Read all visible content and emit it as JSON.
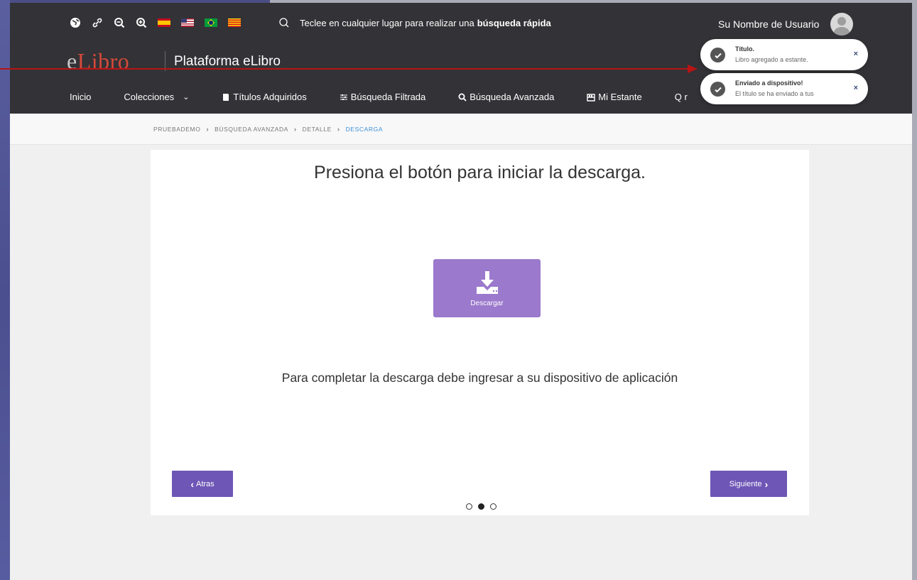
{
  "header": {
    "icons": [
      "globe-icon",
      "link-icon",
      "zoom-out-icon",
      "zoom-in-icon"
    ],
    "flags": [
      "flag-spain",
      "flag-usa",
      "flag-brazil",
      "flag-catalonia"
    ],
    "quick_search_text": "Teclee en cualquier lugar para realizar una",
    "quick_search_bold": "búsqueda rápida",
    "username": "Su Nombre de Usuario",
    "logo_e": "e",
    "logo_libro": "Libro",
    "platform_name": "Plataforma eLibro"
  },
  "nav": {
    "items": [
      {
        "label": "Inicio"
      },
      {
        "label": "Colecciones",
        "chevron": "⌄"
      },
      {
        "label": "Títulos Adquiridos"
      },
      {
        "label": "Búsqueda Filtrada"
      },
      {
        "label": "Búsqueda Avanzada"
      },
      {
        "label": "Mi Estante"
      },
      {
        "label": "Q r"
      }
    ]
  },
  "breadcrumb": {
    "items": [
      "PRUEBADEMO",
      "BÚSQUEDA AVANZADA",
      "DETALLE",
      "DESCARGA"
    ],
    "separator": "›"
  },
  "main": {
    "title": "Presiona el botón para iniciar la descarga.",
    "download_label": "Descargar",
    "message": "Para completar la descarga debe ingresar a su dispositivo de aplicación",
    "back_label": "Atras",
    "back_icon": "‹",
    "next_label": "Siguiente",
    "next_icon": "›",
    "pagination": {
      "total": 3,
      "current": 2
    }
  },
  "toasts": [
    {
      "title": "Título.",
      "body": "Libro agregado a estante.",
      "close": "×"
    },
    {
      "title": "Enviado a dispositivo!",
      "body": "El título se ha enviado a tus",
      "close": "×"
    }
  ],
  "colors": {
    "topbar": "#333236",
    "accent_purple": "#6e56b6",
    "download_purple": "#9b79cc",
    "breadcrumb_active": "#3a8fd9",
    "annotation_arrow": "#b81414"
  }
}
